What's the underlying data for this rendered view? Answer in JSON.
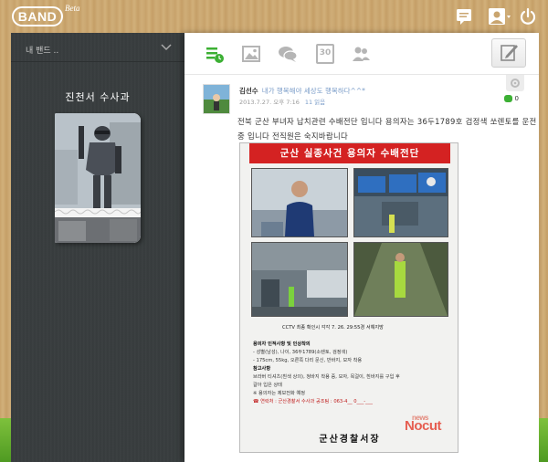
{
  "header": {
    "logo_text": "BAND",
    "beta_label": "Beta"
  },
  "left_panel": {
    "band_selector_label": "내 밴드 ..",
    "band_name": "진천서 수사과"
  },
  "tabs": [
    {
      "icon": "timeline-icon"
    },
    {
      "icon": "photo-icon"
    },
    {
      "icon": "chat-icon"
    },
    {
      "icon": "calendar-icon",
      "label": "30"
    },
    {
      "icon": "members-icon"
    }
  ],
  "post": {
    "author": "김선수",
    "status": "내가 행복해야 세상도 행복하다^^*",
    "date": "2013.7.27. 오후 7:16",
    "read_count": "11 읽음",
    "comment_count": "0",
    "text": "전북 군산 부녀자 납치관련 수배전단 입니다 용의자는 36두1789호 검정색 쏘렌토를 운전중 입니다 전직원은 숙지바랍니다",
    "poster": {
      "headline": "군산 실종사건 용의자 수배전단",
      "cctv_caption": "CCTV 최종 확인시 각각 7. 26. 29:55경 서해지방",
      "section1_title": "용의자 인적사항 및 인상착의",
      "section1_line1": "- 성별(남성), 나이, 36두1789(소렌토, 검정색)",
      "section1_line2": "- 175cm, 55kg, 오른쪽 다리 문신, 반바지, 모자 착용",
      "section2_title": "참고사항",
      "section2_line1": "브라버 티셔츠(흰색 상의), 청바지 착용 중, 모자, 목걸이, 흰바지를 구입 후",
      "section2_line2": "갈아 입은 상태",
      "note": "※ 용의자는 제보전화 예정",
      "contact": "☎ 연락처 : 군산경찰서 수사과 공조팀 : 063-4__ 0___-___",
      "footer": "군산경찰서장",
      "watermark_small": "news",
      "watermark": "Nocut"
    }
  }
}
